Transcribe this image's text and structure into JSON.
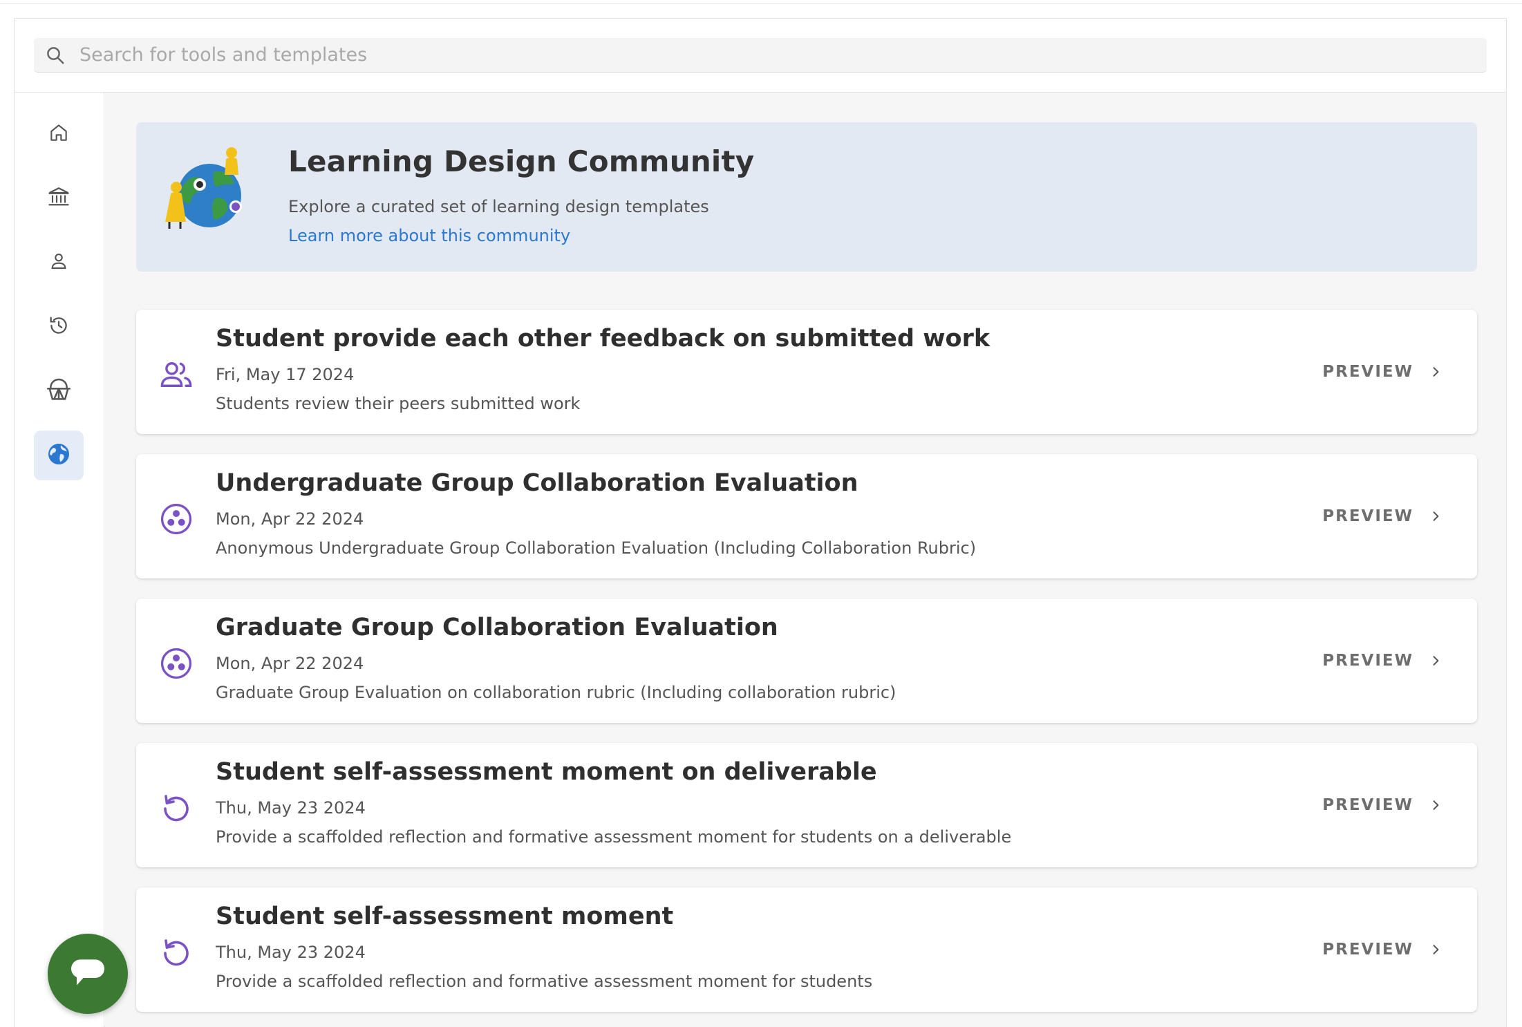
{
  "search": {
    "placeholder": "Search for tools and templates"
  },
  "sidebar": {
    "items": [
      {
        "icon": "home-icon"
      },
      {
        "icon": "institution-icon"
      },
      {
        "icon": "person-icon"
      },
      {
        "icon": "history-icon"
      },
      {
        "icon": "basket-icon"
      },
      {
        "icon": "globe-icon",
        "active": true
      }
    ]
  },
  "banner": {
    "title": "Learning Design Community",
    "subtitle": "Explore a curated set of learning design templates",
    "link": "Learn more about this community"
  },
  "templates": [
    {
      "title": "Student provide each other feedback on submitted work",
      "date": "Fri, May 17 2024",
      "description": "Students review their peers submitted work",
      "icon": "people-icon",
      "action": "PREVIEW"
    },
    {
      "title": "Undergraduate Group Collaboration Evaluation",
      "date": "Mon, Apr 22 2024",
      "description": "Anonymous Undergraduate Group Collaboration Evaluation (Including Collaboration Rubric)",
      "icon": "group-circle-icon",
      "action": "PREVIEW"
    },
    {
      "title": "Graduate Group Collaboration Evaluation",
      "date": "Mon, Apr 22 2024",
      "description": "Graduate Group Evaluation on collaboration rubric (Including collaboration rubric)",
      "icon": "group-circle-icon",
      "action": "PREVIEW"
    },
    {
      "title": "Student self-assessment moment on deliverable",
      "date": "Thu, May 23 2024",
      "description": "Provide a scaffolded reflection and formative assessment moment for students on a deliverable",
      "icon": "refresh-icon",
      "action": "PREVIEW"
    },
    {
      "title": "Student self-assessment moment",
      "date": "Thu, May 23 2024",
      "description": "Provide a scaffolded reflection and formative assessment moment for students",
      "icon": "refresh-icon",
      "action": "PREVIEW"
    }
  ],
  "colors": {
    "accent_purple": "#7b52c4",
    "link_blue": "#2a78d0",
    "banner_bg": "#e3e9f3",
    "chat_green": "#3c7a34"
  },
  "chat": {
    "icon": "chat-bubble-icon"
  }
}
